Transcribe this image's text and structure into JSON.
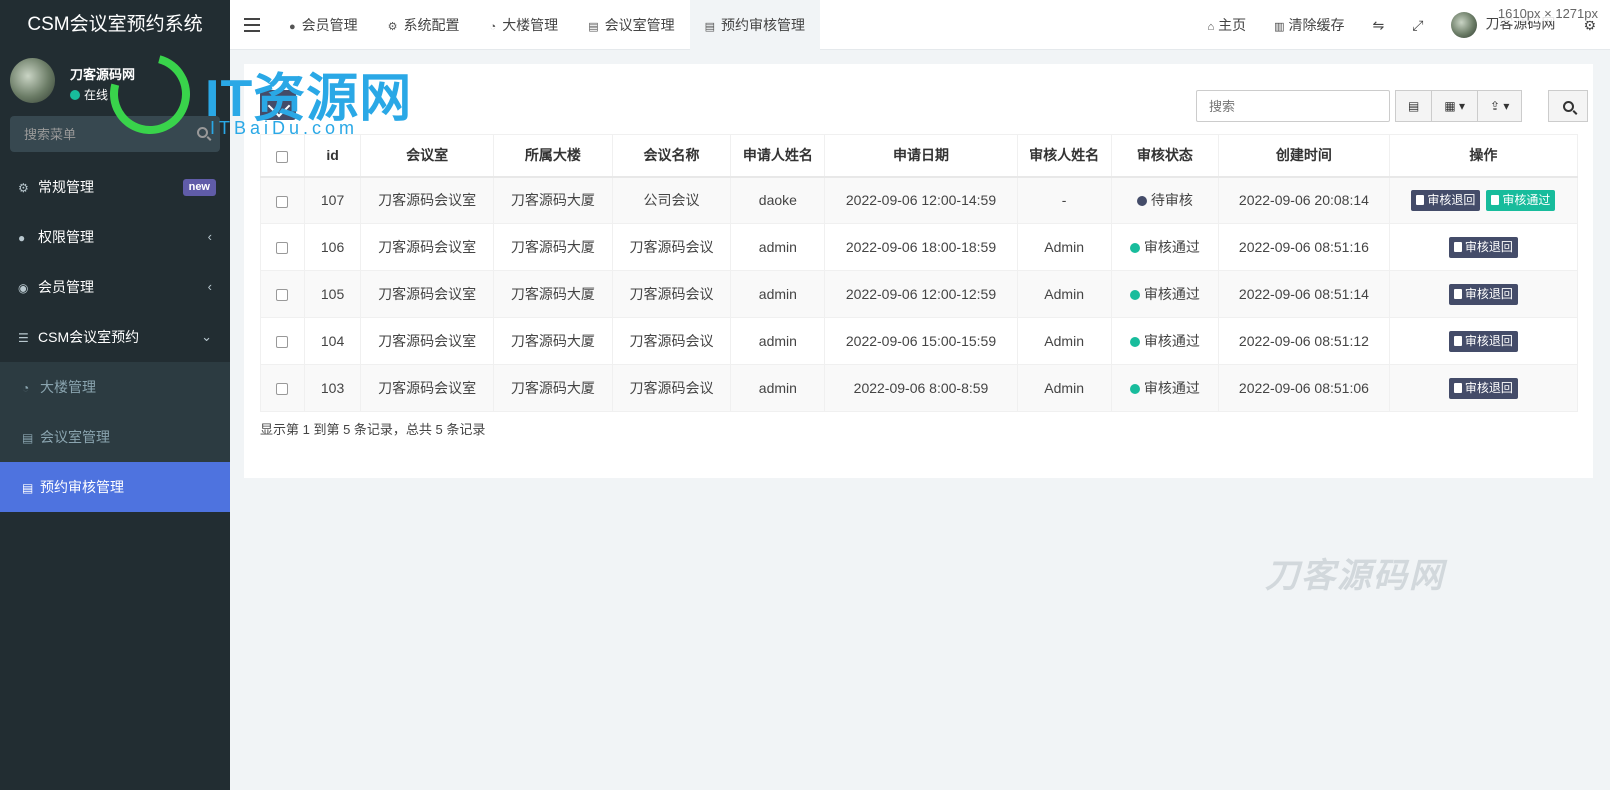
{
  "app": {
    "title": "CSM会议室预约系统"
  },
  "user": {
    "name": "刀客源码网",
    "status": "在线"
  },
  "sidebar": {
    "search_placeholder": "搜索菜单",
    "items": [
      {
        "label": "常规管理",
        "icon": "cogs-icon",
        "badge": "new"
      },
      {
        "label": "权限管理",
        "icon": "users-icon",
        "caret": "‹"
      },
      {
        "label": "会员管理",
        "icon": "user-circle-icon",
        "caret": "‹"
      },
      {
        "label": "CSM会议室预约",
        "icon": "list-icon",
        "caret": "⌄"
      }
    ],
    "subitems": [
      {
        "label": "大楼管理",
        "icon": "dashboard-icon"
      },
      {
        "label": "会议室管理",
        "icon": "file-icon"
      },
      {
        "label": "预约审核管理",
        "icon": "file-icon",
        "active": true
      }
    ]
  },
  "watermark": {
    "logo_text": "IT资源网",
    "logo_sub": "ITBaiDu.com",
    "faint_text": "刀客源码网"
  },
  "navbar": {
    "tabs": [
      {
        "label": "会员管理",
        "icon": "user-icon"
      },
      {
        "label": "系统配置",
        "icon": "cog-icon"
      },
      {
        "label": "大楼管理",
        "icon": "dashboard-icon"
      },
      {
        "label": "会议室管理",
        "icon": "file-icon"
      },
      {
        "label": "预约审核管理",
        "icon": "file-icon",
        "active": true
      }
    ],
    "right": {
      "home": "主页",
      "clear_cache": "清除缓存",
      "user": "刀客源码网"
    },
    "dimension_overlay": "1610px × 1271px"
  },
  "toolbar": {
    "search_placeholder": "搜索"
  },
  "table": {
    "columns": [
      "id",
      "会议室",
      "所属大楼",
      "会议名称",
      "申请人姓名",
      "申请日期",
      "审核人姓名",
      "审核状态",
      "创建时间",
      "操作"
    ],
    "rows": [
      {
        "id": "107",
        "room": "刀客源码会议室",
        "building": "刀客源码大厦",
        "meeting": "公司会议",
        "applicant": "daoke",
        "date": "2022-09-06 12:00-14:59",
        "reviewer": "-",
        "status": "待审核",
        "status_type": "pending",
        "created": "2022-09-06 20:08:14",
        "actions": [
          "审核退回",
          "审核通过"
        ]
      },
      {
        "id": "106",
        "room": "刀客源码会议室",
        "building": "刀客源码大厦",
        "meeting": "刀客源码会议",
        "applicant": "admin",
        "date": "2022-09-06 18:00-18:59",
        "reviewer": "Admin",
        "status": "审核通过",
        "status_type": "pass",
        "created": "2022-09-06 08:51:16",
        "actions": [
          "审核退回"
        ]
      },
      {
        "id": "105",
        "room": "刀客源码会议室",
        "building": "刀客源码大厦",
        "meeting": "刀客源码会议",
        "applicant": "admin",
        "date": "2022-09-06 12:00-12:59",
        "reviewer": "Admin",
        "status": "审核通过",
        "status_type": "pass",
        "created": "2022-09-06 08:51:14",
        "actions": [
          "审核退回"
        ]
      },
      {
        "id": "104",
        "room": "刀客源码会议室",
        "building": "刀客源码大厦",
        "meeting": "刀客源码会议",
        "applicant": "admin",
        "date": "2022-09-06 15:00-15:59",
        "reviewer": "Admin",
        "status": "审核通过",
        "status_type": "pass",
        "created": "2022-09-06 08:51:12",
        "actions": [
          "审核退回"
        ]
      },
      {
        "id": "103",
        "room": "刀客源码会议室",
        "building": "刀客源码大厦",
        "meeting": "刀客源码会议",
        "applicant": "admin",
        "date": "2022-09-06 8:00-8:59",
        "reviewer": "Admin",
        "status": "审核通过",
        "status_type": "pass",
        "created": "2022-09-06 08:51:06",
        "actions": [
          "审核退回"
        ]
      }
    ]
  },
  "pager": {
    "info": "显示第 1 到第 5 条记录，总共 5 条记录"
  },
  "colors": {
    "sidebar_bg": "#222d32",
    "active_menu": "#4e73df",
    "success": "#18bc9c",
    "navy_btn": "#444c69"
  }
}
